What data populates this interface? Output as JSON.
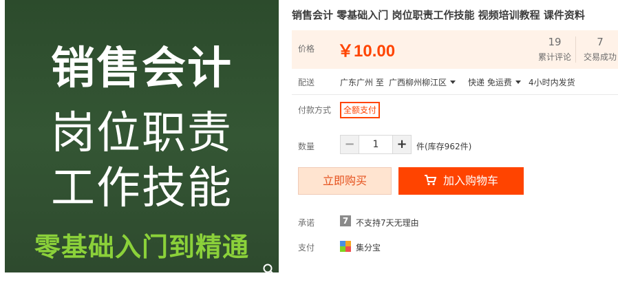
{
  "image": {
    "line1": "销售会计",
    "line2": "岗位职责",
    "line3": "工作技能",
    "line4": "零基础入门到精通"
  },
  "title": "销售会计 零基础入门 岗位职责工作技能 视频培训教程 课件资料",
  "price": {
    "label": "价格",
    "value": "￥10.00",
    "reviews_count": "19",
    "reviews_label": "累计评论",
    "trades_count": "7",
    "trades_label": "交易成功"
  },
  "shipping": {
    "label": "配送",
    "from": "广东广州 至",
    "to": "广西柳州柳江区",
    "method": "快递 免运费",
    "time": "4小时内发货"
  },
  "payment_method": {
    "label": "付款方式",
    "option": "全额支付"
  },
  "quantity": {
    "label": "数量",
    "minus": "−",
    "value": "1",
    "plus": "+",
    "stock": "件(库存962件)"
  },
  "buttons": {
    "buy_now": "立即购买",
    "add_to_cart": "加入购物车"
  },
  "promise": {
    "label": "承诺",
    "icon_text": "7",
    "text": "不支持7天无理由"
  },
  "pay": {
    "label": "支付",
    "text": "集分宝"
  },
  "colors": {
    "accent": "#ff4400",
    "price_bg": "#fff2e8",
    "image_bg": "#2f4f2f",
    "image_highlight": "#8bd13a"
  }
}
